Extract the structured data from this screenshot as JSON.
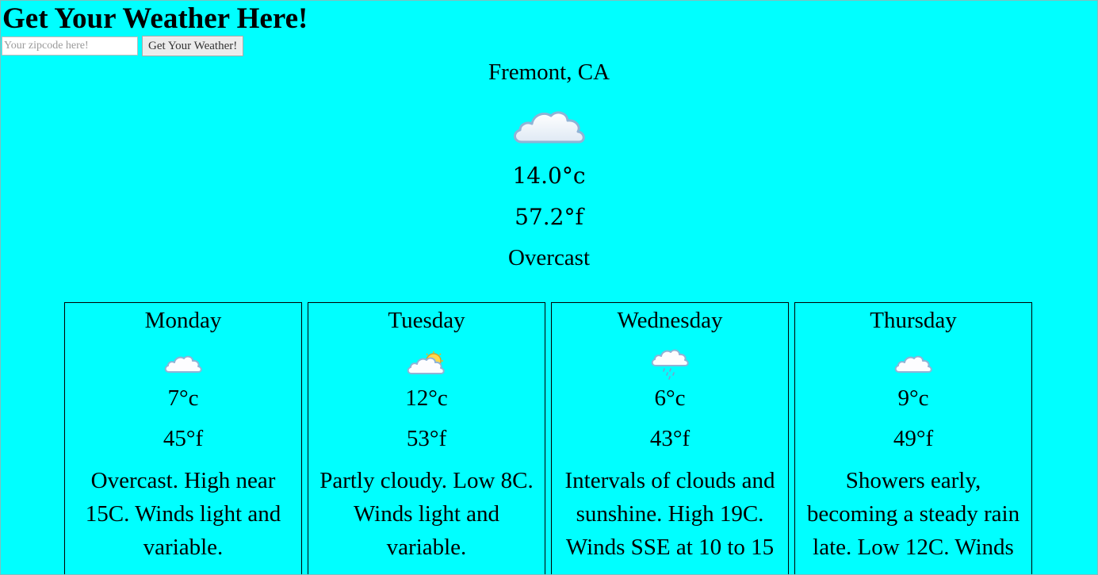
{
  "header": {
    "title": "Get Your Weather Here!"
  },
  "search": {
    "placeholder": "Your zipcode here!",
    "value": "",
    "button_label": "Get Your Weather!"
  },
  "current": {
    "location": "Fremont, CA",
    "icon": "cloudy-icon",
    "temp_c": "14.0°c",
    "temp_f": "57.2°f",
    "condition": "Overcast"
  },
  "forecast": [
    {
      "day": "Monday",
      "icon": "cloudy-icon",
      "temp_c": "7°c",
      "temp_f": "45°f",
      "description": "Overcast. High near 15C. Winds light and variable."
    },
    {
      "day": "Tuesday",
      "icon": "partly-cloudy-icon",
      "temp_c": "12°c",
      "temp_f": "53°f",
      "description": "Partly cloudy. Low 8C. Winds light and variable."
    },
    {
      "day": "Wednesday",
      "icon": "rain-cloud-icon",
      "temp_c": "6°c",
      "temp_f": "43°f",
      "description": "Intervals of clouds and sunshine. High 19C. Winds SSE at 10 to 15"
    },
    {
      "day": "Thursday",
      "icon": "cloudy-icon",
      "temp_c": "9°c",
      "temp_f": "49°f",
      "description": "Showers early, becoming a steady rain late. Low 12C. Winds"
    }
  ],
  "colors": {
    "background": "#00ffff",
    "text": "#000000"
  }
}
